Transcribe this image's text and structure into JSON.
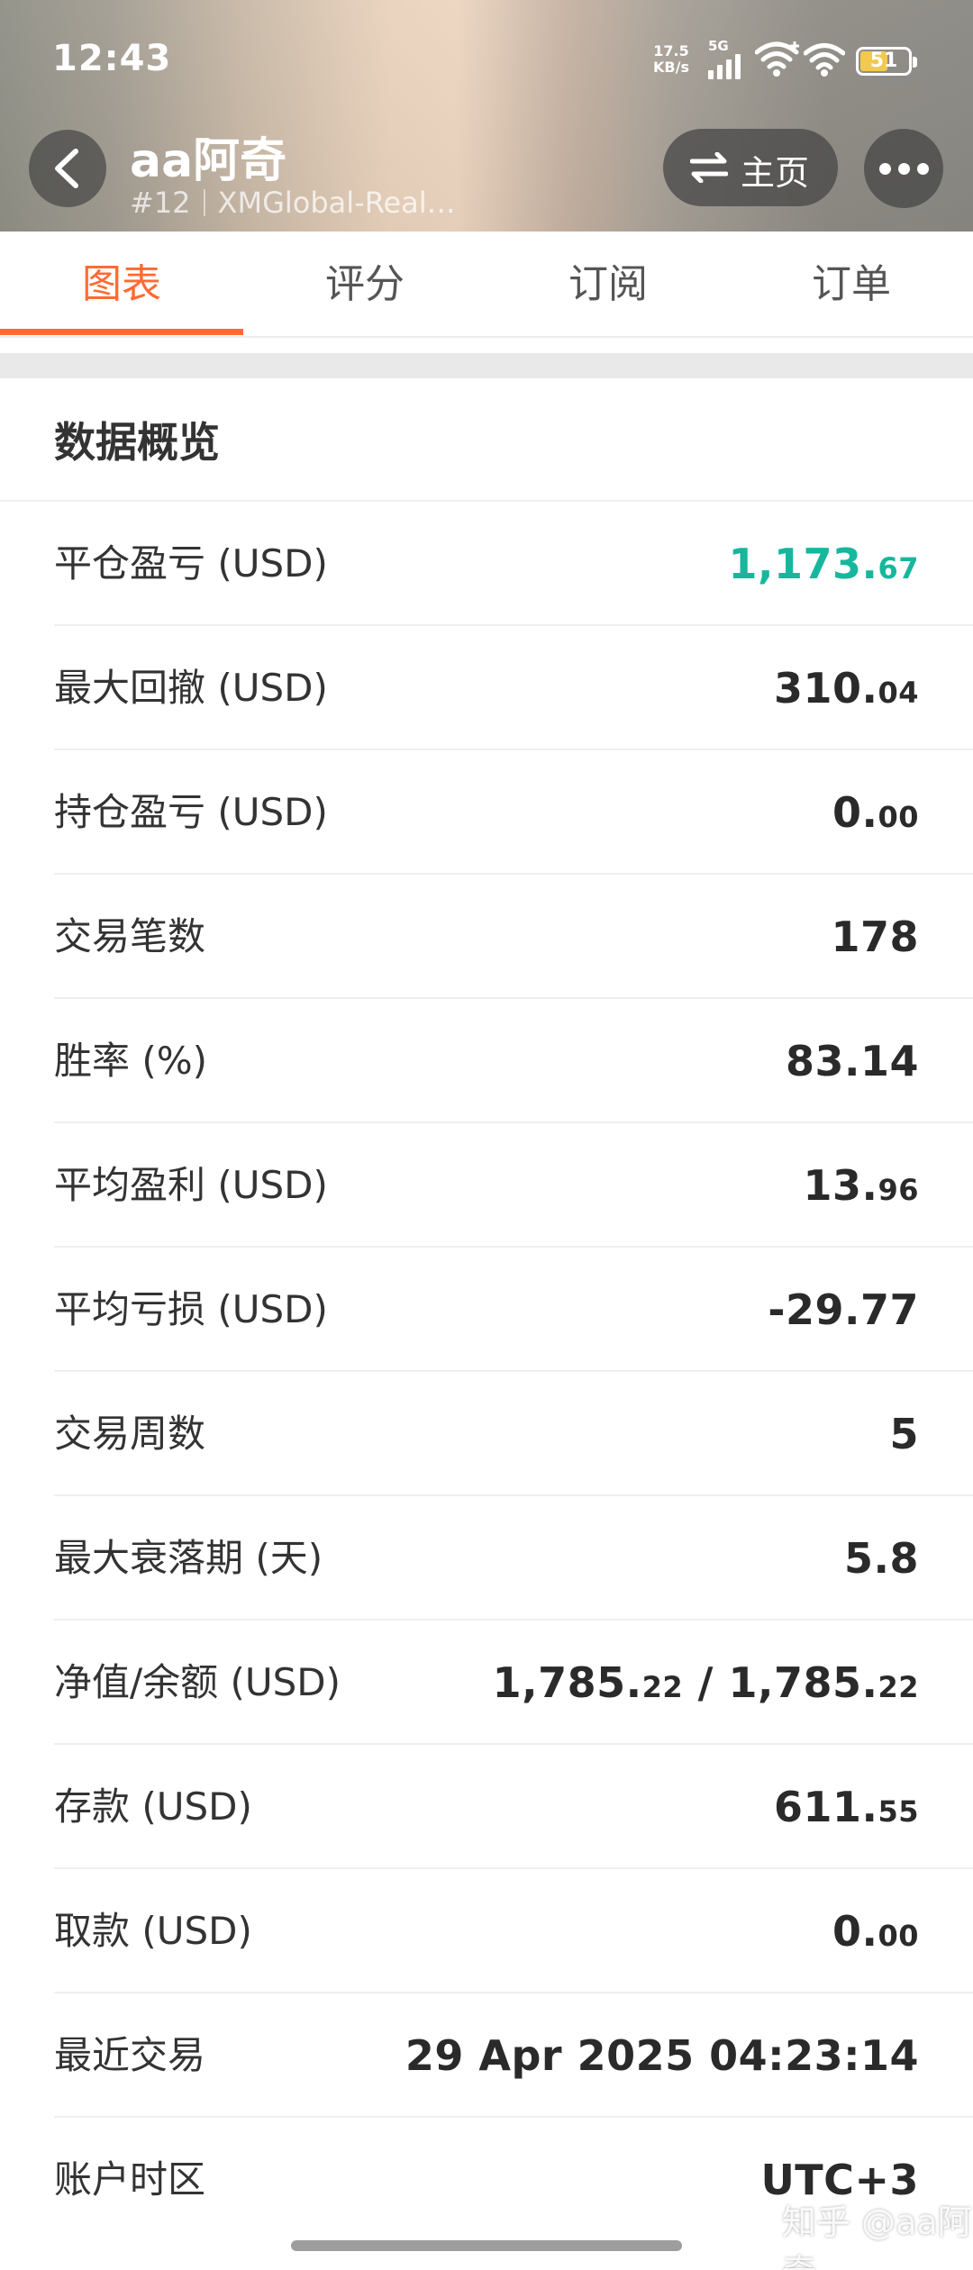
{
  "status_bar": {
    "time": "12:43",
    "net_speed_value": "17.5",
    "net_speed_unit": "KB/s",
    "network": "5G",
    "battery": "51"
  },
  "header": {
    "title": "aa阿奇",
    "rank": "#12",
    "account": "XMGlobal-Real…",
    "home_label": "主页",
    "icons": {
      "back": "chevron-left-icon",
      "switch": "swap-arrows-icon",
      "more": "more-dots-icon"
    }
  },
  "tabs": [
    {
      "label": "图表",
      "active": true
    },
    {
      "label": "评分",
      "active": false
    },
    {
      "label": "订阅",
      "active": false
    },
    {
      "label": "订单",
      "active": false
    }
  ],
  "overview": {
    "title": "数据概览",
    "rows": [
      {
        "label": "平仓盈亏 (USD)",
        "int": "1,173.",
        "dec": "67",
        "color": "#16b79c"
      },
      {
        "label": "最大回撤 (USD)",
        "int": "310.",
        "dec": "04"
      },
      {
        "label": "持仓盈亏 (USD)",
        "int": "0.",
        "dec": "00"
      },
      {
        "label": "交易笔数",
        "int": "178",
        "dec": ""
      },
      {
        "label": "胜率 (%)",
        "int": "83.14",
        "dec": ""
      },
      {
        "label": "平均盈利 (USD)",
        "int": "13.",
        "dec": "96"
      },
      {
        "label": "平均亏损 (USD)",
        "int": "-29.77",
        "dec": ""
      },
      {
        "label": "交易周数",
        "int": "5",
        "dec": ""
      },
      {
        "label": "最大衰落期 (天)",
        "int": "5.8",
        "dec": ""
      },
      {
        "label": "净值/余额 (USD)",
        "int": "1,785.",
        "dec": "22",
        "int2": " / 1,785.",
        "dec2": "22"
      },
      {
        "label": "存款 (USD)",
        "int": "611.",
        "dec": "55"
      },
      {
        "label": "取款 (USD)",
        "int": "0.",
        "dec": "00"
      },
      {
        "label": "最近交易",
        "int": "29 Apr 2025 04:23:14",
        "dec": ""
      },
      {
        "label": "账户时区",
        "int": "UTC+3",
        "dec": ""
      }
    ]
  },
  "watermark": "知乎 @aa阿奇",
  "colors": {
    "accent": "#ff6a33",
    "profit_green": "#16b79c"
  }
}
